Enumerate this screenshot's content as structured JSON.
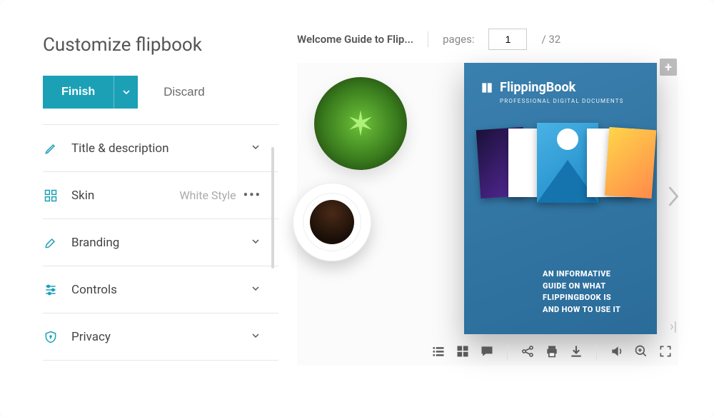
{
  "page_title": "Customize flipbook",
  "actions": {
    "finish": "Finish",
    "discard": "Discard"
  },
  "options": {
    "title_desc": "Title & description",
    "skin": "Skin",
    "skin_value": "White Style",
    "branding": "Branding",
    "controls": "Controls",
    "privacy": "Privacy"
  },
  "preview": {
    "doc_title": "Welcome Guide to Flip...",
    "pages_label": "pages:",
    "current_page": "1",
    "total_pages": "/ 32"
  },
  "cover": {
    "brand": "FlippingBook",
    "subtitle": "PROFESSIONAL DIGITAL DOCUMENTS",
    "guide_line1": "AN INFORMATIVE",
    "guide_line2": "GUIDE ON WHAT",
    "guide_line3": "FLIPPINGBOOK IS",
    "guide_line4": "AND HOW TO USE IT"
  },
  "icons": {
    "pencil": "pencil-icon",
    "grid": "grid-icon",
    "brush": "brush-icon",
    "sliders": "sliders-icon",
    "shield": "shield-icon"
  }
}
